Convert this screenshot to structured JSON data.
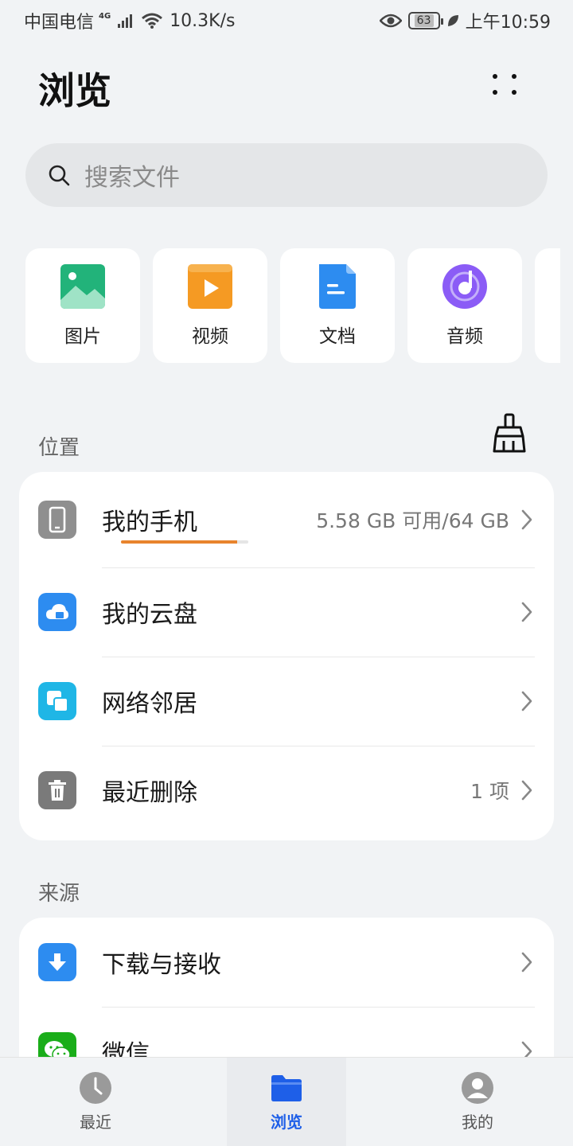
{
  "status_bar": {
    "carrier": "中国电信",
    "network": "4G",
    "speed": "10.3K/s",
    "battery": "63",
    "time": "上午10:59"
  },
  "header": {
    "title": "浏览"
  },
  "search": {
    "placeholder": "搜索文件"
  },
  "categories": [
    {
      "label": "图片",
      "icon": "image-icon",
      "color": "#22b37a"
    },
    {
      "label": "视频",
      "icon": "video-icon",
      "color": "#f59a23"
    },
    {
      "label": "文档",
      "icon": "document-icon",
      "color": "#2d8cf0"
    },
    {
      "label": "音频",
      "icon": "audio-icon",
      "color": "#8b5cf6"
    }
  ],
  "location": {
    "title": "位置",
    "items": [
      {
        "label": "我的手机",
        "value": "5.58 GB 可用/64 GB",
        "usage": 0.91,
        "icon": "phone-icon"
      },
      {
        "label": "我的云盘",
        "value": "",
        "icon": "cloud-icon"
      },
      {
        "label": "网络邻居",
        "value": "",
        "icon": "network-icon"
      },
      {
        "label": "最近删除",
        "value": "1 项",
        "icon": "trash-icon"
      }
    ]
  },
  "source": {
    "title": "来源",
    "items": [
      {
        "label": "下载与接收",
        "icon": "download-icon"
      },
      {
        "label": "微信",
        "icon": "wechat-icon"
      }
    ]
  },
  "bottom_nav": [
    {
      "label": "最近",
      "icon": "clock-icon",
      "active": false
    },
    {
      "label": "浏览",
      "icon": "folder-icon",
      "active": true
    },
    {
      "label": "我的",
      "icon": "profile-icon",
      "active": false
    }
  ],
  "colors": {
    "accent": "#1e5fe8",
    "usage_bar": "#e8842d"
  }
}
